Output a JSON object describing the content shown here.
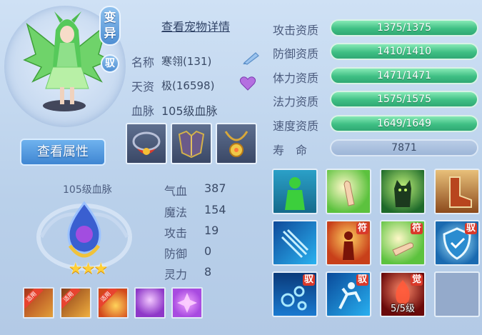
{
  "pet": {
    "variant_badge": "变异",
    "tame_badge": "驭",
    "view_attributes_button": "查看属性",
    "bloodline_emblem_label": "105级血脉",
    "stars": 3
  },
  "details": {
    "title": "查看宠物详情",
    "name_label": "名称",
    "name_value": "寒翎(131)",
    "talent_label": "天资",
    "talent_value": "极(16598)",
    "bloodline_label": "血脉",
    "bloodline_value": "105级血脉"
  },
  "equipment": [
    "necklace-red-icon",
    "armor-icon",
    "amulet-gold-icon"
  ],
  "stats": [
    {
      "label": "气血",
      "value": "387"
    },
    {
      "label": "魔法",
      "value": "154"
    },
    {
      "label": "攻击",
      "value": "19"
    },
    {
      "label": "防御",
      "value": "0"
    },
    {
      "label": "灵力",
      "value": "8"
    }
  ],
  "aptitudes": [
    {
      "label": "攻击资质",
      "value": "1375/1375"
    },
    {
      "label": "防御资质",
      "value": "1410/1410"
    },
    {
      "label": "体力资质",
      "value": "1471/1471"
    },
    {
      "label": "法力资质",
      "value": "1575/1575"
    },
    {
      "label": "速度资质",
      "value": "1649/1649"
    }
  ],
  "lifespan": {
    "label": "寿　命",
    "value": "7871"
  },
  "small_skills": {
    "use_tag": "适用",
    "items": [
      "skill-fire-icon",
      "skill-flame-slash-icon",
      "skill-fireball-icon",
      "skill-purple-burst-icon",
      "skill-purple-cross-icon"
    ]
  },
  "skills": [
    {
      "icon": "skill-green-silhouette-icon",
      "badge": "",
      "level": ""
    },
    {
      "icon": "skill-palm-icon",
      "badge": "",
      "level": ""
    },
    {
      "icon": "skill-green-cat-icon",
      "badge": "",
      "level": ""
    },
    {
      "icon": "skill-boot-icon",
      "badge": "",
      "level": ""
    },
    {
      "icon": "skill-blue-feather-icon",
      "badge": "",
      "level": ""
    },
    {
      "icon": "skill-red-figure-icon",
      "badge": "符",
      "level": ""
    },
    {
      "icon": "skill-green-hand-icon",
      "badge": "符",
      "level": ""
    },
    {
      "icon": "skill-shield-icon",
      "badge": "驭",
      "level": ""
    },
    {
      "icon": "skill-blue-orbs-icon",
      "badge": "驭",
      "level": ""
    },
    {
      "icon": "skill-running-figure-icon",
      "badge": "驭",
      "level": ""
    },
    {
      "icon": "skill-red-awaken-icon",
      "badge": "觉",
      "level": "5/5级"
    },
    {
      "icon": "empty-slot",
      "badge": "",
      "level": ""
    }
  ],
  "colors": {
    "bar_green": "#3fbf84",
    "button_blue": "#4f8fd3",
    "badge_red": "#d9392a",
    "star_gold": "#ffcf36"
  }
}
